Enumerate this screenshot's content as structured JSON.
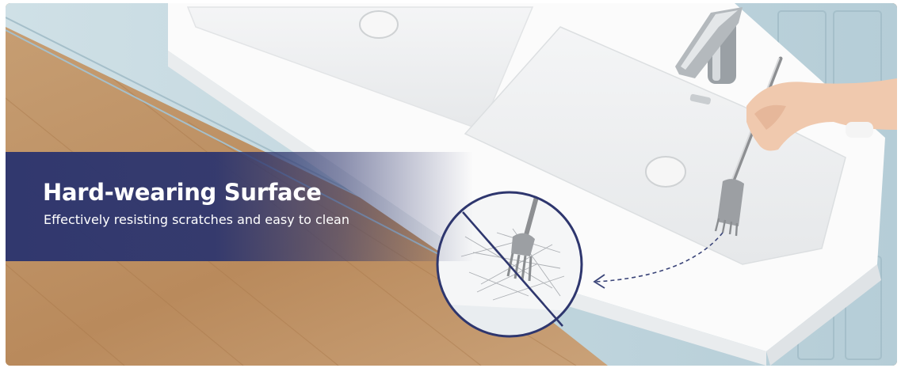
{
  "banner": {
    "headline": "Hard-wearing Surface",
    "subline": "Effectively resisting scratches and easy to clean"
  },
  "colors": {
    "banner_blue": "#2e366e",
    "cabinet_blue": "#bcd3dc",
    "wood_floor": "#c9a27a",
    "basin_white": "#fafafa"
  }
}
